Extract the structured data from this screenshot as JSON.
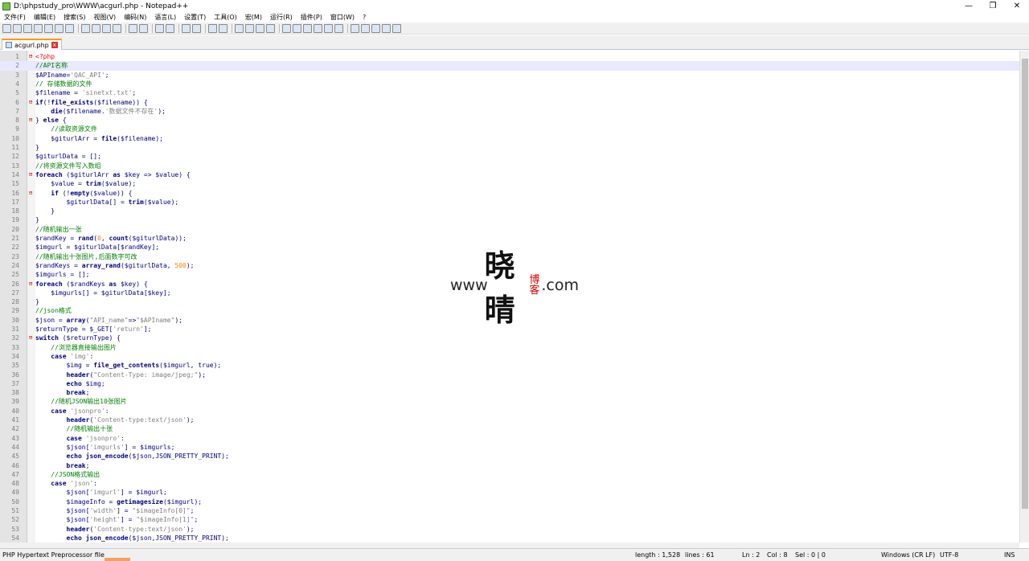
{
  "window": {
    "title": "D:\\phpstudy_pro\\WWW\\acgurl.php - Notepad++",
    "min": "—",
    "restore": "❐",
    "close": "✕"
  },
  "menu": [
    "文件(F)",
    "编辑(E)",
    "搜索(S)",
    "视图(V)",
    "编码(N)",
    "语言(L)",
    "设置(T)",
    "工具(O)",
    "宏(M)",
    "运行(R)",
    "插件(P)",
    "窗口(W)",
    "?"
  ],
  "tab": {
    "label": "acgurl.php",
    "close": "x"
  },
  "current_line": 2,
  "lines": [
    "<?php",
    "//API名称",
    "$APIname='QAC_API';",
    "// 存储数据的文件",
    "$filename = 'sinetxt.txt';",
    "if(!file_exists($filename)) {",
    "    die($filename.'数据文件不存在');",
    "} else {",
    "    //读取资源文件",
    "    $giturlArr = file($filename);",
    "}",
    "$giturlData = [];",
    "//将资源文件写入数组",
    "foreach ($giturlArr as $key => $value) {",
    "    $value = trim($value);",
    "    if (!empty($value)) {",
    "        $giturlData[] = trim($value);",
    "    }",
    "}",
    "//随机输出一张",
    "$randKey = rand(0, count($giturlData));",
    "$imgurl = $giturlData[$randKey];",
    "//随机输出十张图片,后面数字可改",
    "$randKeys = array_rand($giturlData, 500);",
    "$imgurls = [];",
    "foreach ($randKeys as $key) {",
    "    $imgurls[] = $giturlData[$key];",
    "}",
    "//json格式",
    "$json = array(\"API_name\"=>\"$APIname\");",
    "$returnType = $_GET['return'];",
    "switch ($returnType) {",
    "    //浏览器直接输出图片",
    "    case 'img':",
    "        $img = file_get_contents($imgurl, true);",
    "        header(\"Content-Type: image/jpeg;\");",
    "        echo $img;",
    "        break;",
    "    //随机JSON输出10张图片",
    "    case 'jsonpro':",
    "        header('Content-type:text/json');",
    "        //随机输出十张",
    "        case 'jsonpro':",
    "        $json['imgurls'] = $imgurls;",
    "        echo json_encode($json,JSON_PRETTY_PRINT);",
    "        break;",
    "    //JSON格式输出",
    "    case 'json':",
    "        $json['imgurl'] = $imgurl;",
    "        $imageInfo = getimagesize($imgurl);",
    "        $json['width'] = \"$imageInfo[0]\";",
    "        $json['height'] = \"$imageInfo[1]\";",
    "        header('Content-type:text/json');",
    "        echo json_encode($json,JSON_PRETTY_PRINT);"
  ],
  "fold_lines": [
    1,
    6,
    8,
    14,
    16,
    26,
    32
  ],
  "status": {
    "language": "PHP Hypertext Preprocessor file",
    "length": "length : 1,528",
    "lines": "lines : 61",
    "ln": "Ln : 2",
    "col": "Col : 8",
    "sel": "Sel : 0 | 0",
    "eol": "Windows (CR LF)",
    "encoding": "UTF-8",
    "mode": "INS"
  },
  "watermark": {
    "left": "www",
    "big": "晓晴",
    "small": "博客",
    "right": ".com"
  },
  "colors": {
    "comment": "#008000",
    "keyword": "#000080",
    "string": "#808080",
    "tab_accent": "#ff9900",
    "fold": "#cc0000"
  }
}
